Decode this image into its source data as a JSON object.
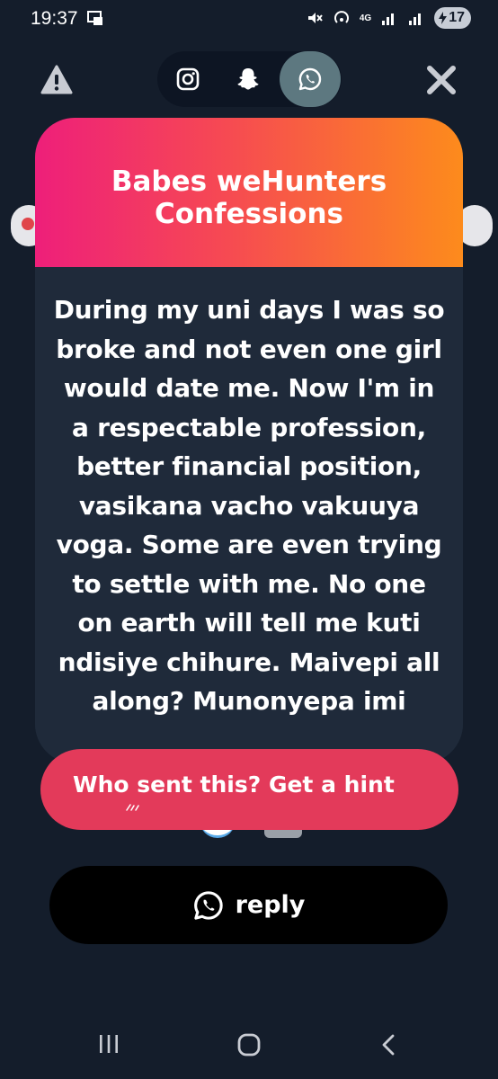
{
  "status_bar": {
    "time": "19:37",
    "network_label": "4G",
    "battery_level": "17"
  },
  "toolbar": {
    "share_targets": [
      "instagram",
      "snapchat",
      "whatsapp"
    ],
    "selected_share_target": "whatsapp"
  },
  "card": {
    "title": "Babes weHunters Confessions",
    "message": "During my uni days I was so broke and not even one girl would date me. Now I'm in a respectable profession, better financial position, vasikana vacho vakuuya voga. Some are even trying to settle with me. No one on earth will tell me kuti ndisiye chihure. Maivepi all along? Munonyepa imi"
  },
  "hint_button": {
    "label": "Who sent this? Get a hint"
  },
  "reply_button": {
    "label": "reply"
  },
  "icons": {
    "warning": "warning-icon",
    "close": "close-icon",
    "instagram": "instagram-icon",
    "snapchat": "snapchat-icon",
    "whatsapp": "whatsapp-icon",
    "mute": "mute-icon",
    "hotspot": "hotspot-icon",
    "signal": "signal-icon"
  },
  "colors": {
    "background": "#141d2b",
    "card_body": "#1f2a3a",
    "header_gradient_start": "#ee1f7a",
    "header_gradient_end": "#fd8b1c",
    "hint_button": "#e33a5a",
    "reply_button": "#000000",
    "selected_share": "#5d7880"
  }
}
